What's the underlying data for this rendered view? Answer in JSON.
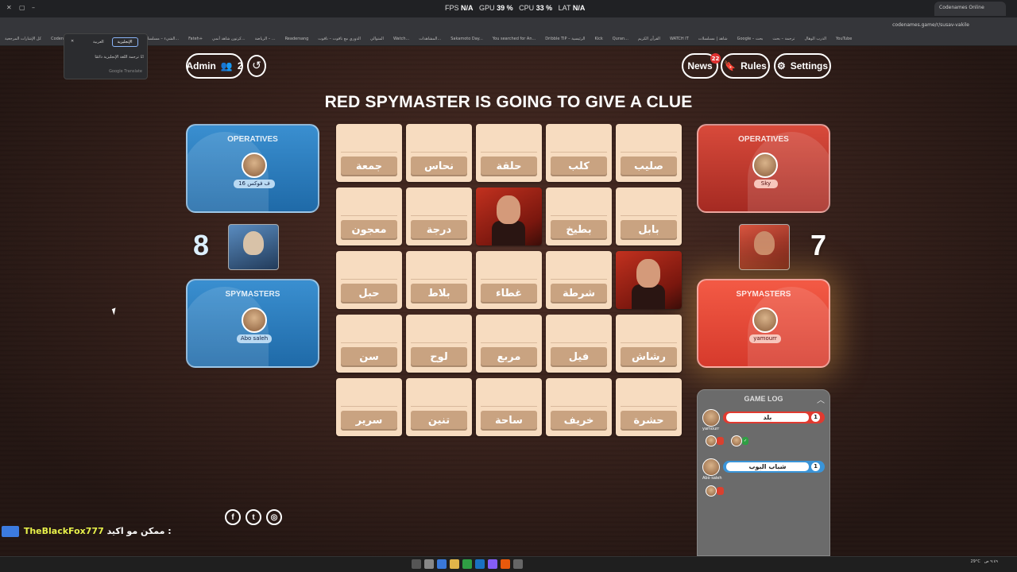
{
  "browser": {
    "stats": {
      "fps_label": "FPS",
      "fps": "N/A",
      "gpu_label": "GPU",
      "gpu": "39 %",
      "cpu_label": "CPU",
      "cpu": "33 %",
      "lat_label": "LAT",
      "lat": "N/A"
    },
    "tab_title": "Codenames Online",
    "url": "codenames.game/r/susav-vakile",
    "bookmarks": [
      "كل الإشارات المرجعية",
      "Codenames - Play...",
      "The All-devices...",
      "الشيء – مسلسلات...",
      "Fateh+",
      "كرتون شاهد أنمي...",
      "الرياضة – ...",
      "Readersang",
      "الدوري مع ناقوت – ناقوت",
      "المتوالي",
      "Watch...",
      "المشاهدات...",
      "Sakamoto Day...",
      "You searched for An...",
      "Dribble TIP – الرئيسية",
      "Kick",
      "Quran...",
      "القرآن الكريم",
      "WATCH IT",
      "شاهد | مسلسلات",
      "Google – بحث",
      "ترجمة – بحث",
      "الدرب الوهال",
      "YouTube"
    ],
    "translate": {
      "tab_en": "الإنجليزية",
      "tab_ar": "العربية",
      "option": "ترجمة اللغة الإنجليزية دائمًا",
      "footer": "Google Translate"
    }
  },
  "toolbar": {
    "admin_label": "Admin",
    "player_count": "2",
    "news_label": "News",
    "news_badge": "22",
    "rules_label": "Rules",
    "settings_label": "Settings"
  },
  "headline": "RED SPYMASTER IS GOING TO GIVE A CLUE",
  "blue_team": {
    "color": "#2a7bbd",
    "score": "8",
    "operatives_label": "OPERATIVES",
    "operative_name": "ف فوكس 16",
    "spymasters_label": "SPYMASTERS",
    "spymaster_name": "Abo saleh"
  },
  "red_team": {
    "color": "#d9412f",
    "score": "7",
    "operatives_label": "OPERATIVES",
    "operative_name": "Sky",
    "spymasters_label": "SPYMASTERS",
    "spymaster_name": "yamourr"
  },
  "board": [
    {
      "word": "جمعة",
      "state": "hidden"
    },
    {
      "word": "نحاس",
      "state": "hidden"
    },
    {
      "word": "حلقة",
      "state": "hidden"
    },
    {
      "word": "كلب",
      "state": "hidden"
    },
    {
      "word": "صليب",
      "state": "hidden"
    },
    {
      "word": "معجون",
      "state": "hidden"
    },
    {
      "word": "درجة",
      "state": "hidden"
    },
    {
      "word": "",
      "state": "red"
    },
    {
      "word": "بطيخ",
      "state": "hidden"
    },
    {
      "word": "بابل",
      "state": "hidden"
    },
    {
      "word": "حبل",
      "state": "hidden"
    },
    {
      "word": "بلاط",
      "state": "hidden"
    },
    {
      "word": "غطاء",
      "state": "hidden"
    },
    {
      "word": "شرطة",
      "state": "hidden"
    },
    {
      "word": "",
      "state": "red"
    },
    {
      "word": "سن",
      "state": "hidden"
    },
    {
      "word": "لوح",
      "state": "hidden"
    },
    {
      "word": "مربع",
      "state": "hidden"
    },
    {
      "word": "فيل",
      "state": "hidden"
    },
    {
      "word": "رشاش",
      "state": "hidden"
    },
    {
      "word": "سرير",
      "state": "hidden"
    },
    {
      "word": "تنين",
      "state": "hidden"
    },
    {
      "word": "ساحة",
      "state": "hidden"
    },
    {
      "word": "خريف",
      "state": "hidden"
    },
    {
      "word": "حشرة",
      "state": "hidden"
    }
  ],
  "game_log": {
    "title": "GAME LOG",
    "entries": [
      {
        "player": "yamourr",
        "team": "red",
        "clue": "بلد",
        "number": "1"
      },
      {
        "player": "Abo saleh",
        "team": "blue",
        "clue": "شباب البوب",
        "number": "1"
      }
    ]
  },
  "social": [
    "f",
    "t",
    "ig"
  ],
  "stream": {
    "message": "ممكن مو اكيد :",
    "handle": "TheBlackFox777"
  },
  "taskbar": {
    "clock": "٩:٤٩ ص",
    "weather": "29°C"
  }
}
